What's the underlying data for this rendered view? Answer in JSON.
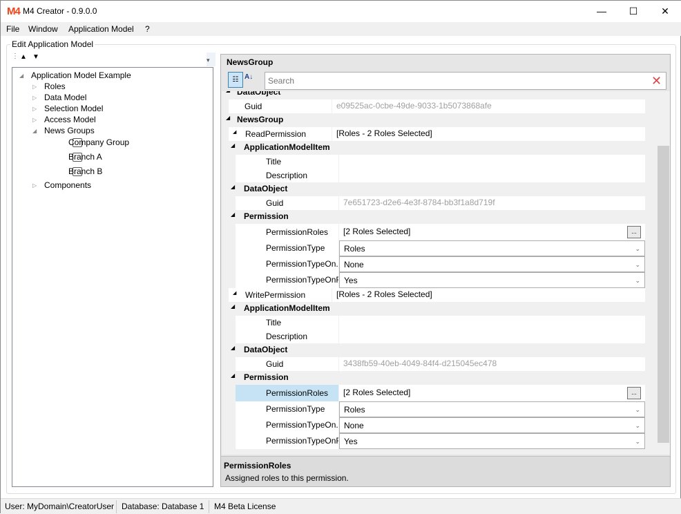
{
  "window": {
    "title": "M4 Creator - 0.9.0.0",
    "logo": "M4",
    "minimize": "—",
    "maximize": "☐",
    "close": "✕"
  },
  "menu": [
    "File",
    "Window",
    "Application Model",
    "?"
  ],
  "group_label": "Edit Application Model",
  "tree": [
    {
      "label": "Application Model Example",
      "level": 0,
      "exp": "◢",
      "icon": false
    },
    {
      "label": "Roles",
      "level": 1,
      "exp": "▷",
      "icon": false
    },
    {
      "label": "Data Model",
      "level": 1,
      "exp": "▷",
      "icon": false
    },
    {
      "label": "Selection Model",
      "level": 1,
      "exp": "▷",
      "icon": false
    },
    {
      "label": "Access Model",
      "level": 1,
      "exp": "▷",
      "icon": false
    },
    {
      "label": "News Groups",
      "level": 1,
      "exp": "◢",
      "icon": false
    },
    {
      "label": "Company Group",
      "level": 2,
      "exp": "",
      "icon": true
    },
    {
      "label": "Branch A",
      "level": 2,
      "exp": "",
      "icon": true
    },
    {
      "label": "Branch B",
      "level": 2,
      "exp": "",
      "icon": true
    },
    {
      "label": "Components",
      "level": 1,
      "exp": "▷",
      "icon": false
    }
  ],
  "property_grid": {
    "title": "NewsGroup",
    "search_placeholder": "Search",
    "rows": [
      {
        "kind": "cat",
        "level": 0,
        "name": "DataObject"
      },
      {
        "kind": "prop",
        "level": 0,
        "name": "Guid",
        "value": "e09525ac-0cbe-49de-9033-1b5073868afe",
        "gray": true
      },
      {
        "kind": "cat",
        "level": 0,
        "name": "NewsGroup"
      },
      {
        "kind": "exprop",
        "level": 0,
        "name": "ReadPermission",
        "value": "[Roles - 2 Roles Selected]"
      },
      {
        "kind": "cat",
        "level": 1,
        "name": "ApplicationModelItem"
      },
      {
        "kind": "prop",
        "level": 1,
        "name": "Title",
        "value": ""
      },
      {
        "kind": "prop",
        "level": 1,
        "name": "Description",
        "value": ""
      },
      {
        "kind": "cat",
        "level": 1,
        "name": "DataObject"
      },
      {
        "kind": "prop",
        "level": 1,
        "name": "Guid",
        "value": "7e651723-d2e6-4e3f-8784-bb3f1a8d719f",
        "gray": true
      },
      {
        "kind": "cat",
        "level": 1,
        "name": "Permission"
      },
      {
        "kind": "roles",
        "level": 1,
        "name": "PermissionRoles",
        "value": "[2 Roles Selected]",
        "button": "..."
      },
      {
        "kind": "dd",
        "level": 1,
        "name": "PermissionType",
        "value": "Roles"
      },
      {
        "kind": "dd",
        "level": 1,
        "name": "PermissionTypeOn...",
        "value": "None"
      },
      {
        "kind": "dd",
        "level": 1,
        "name": "PermissionTypeOnR...",
        "value": "Yes"
      },
      {
        "kind": "exprop",
        "level": 0,
        "name": "WritePermission",
        "value": "[Roles - 2 Roles Selected]"
      },
      {
        "kind": "cat",
        "level": 1,
        "name": "ApplicationModelItem"
      },
      {
        "kind": "prop",
        "level": 1,
        "name": "Title",
        "value": ""
      },
      {
        "kind": "prop",
        "level": 1,
        "name": "Description",
        "value": ""
      },
      {
        "kind": "cat",
        "level": 1,
        "name": "DataObject"
      },
      {
        "kind": "prop",
        "level": 1,
        "name": "Guid",
        "value": "3438fb59-40eb-4049-84f4-d215045ec478",
        "gray": true
      },
      {
        "kind": "cat",
        "level": 1,
        "name": "Permission"
      },
      {
        "kind": "roles",
        "level": 1,
        "name": "PermissionRoles",
        "value": "[2 Roles Selected]",
        "button": "...",
        "selected": true
      },
      {
        "kind": "dd",
        "level": 1,
        "name": "PermissionType",
        "value": "Roles"
      },
      {
        "kind": "dd",
        "level": 1,
        "name": "PermissionTypeOn...",
        "value": "None"
      },
      {
        "kind": "dd",
        "level": 1,
        "name": "PermissionTypeOnR...",
        "value": "Yes"
      }
    ],
    "description": {
      "title": "PermissionRoles",
      "text": "Assigned roles to this permission."
    }
  },
  "status": {
    "user": "User: MyDomain\\CreatorUser",
    "database": "Database: Database 1",
    "license": "M4 Beta License"
  }
}
